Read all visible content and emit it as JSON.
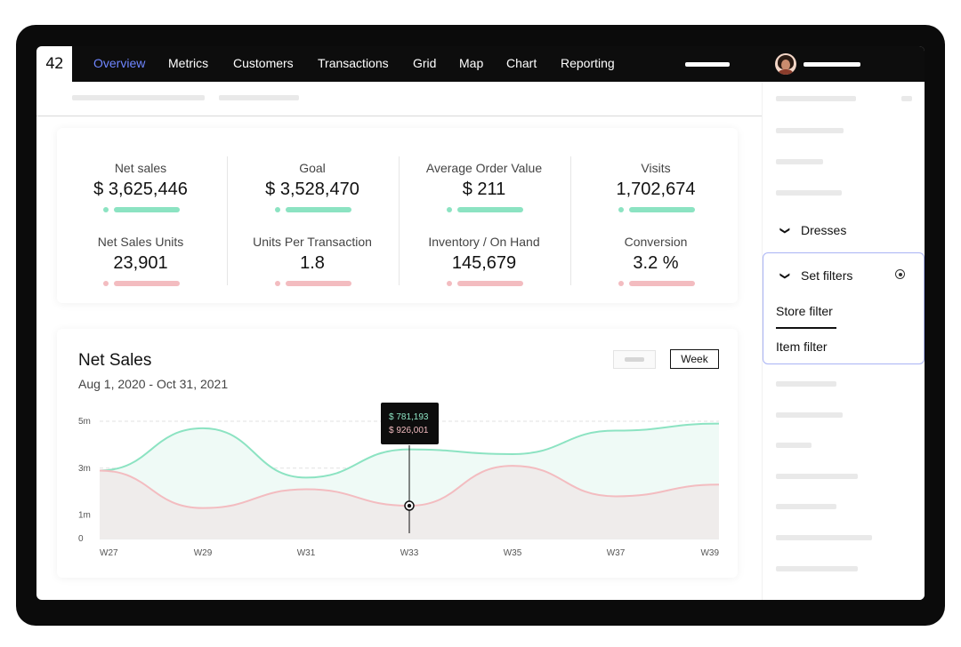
{
  "app": {
    "logo": "42"
  },
  "nav": {
    "items": [
      "Overview",
      "Metrics",
      "Customers",
      "Transactions",
      "Grid",
      "Map",
      "Chart",
      "Reporting"
    ],
    "active": "Overview"
  },
  "kpis": [
    {
      "label": "Net sales",
      "value": "$ 3,625,446",
      "status": "green"
    },
    {
      "label": "Goal",
      "value": "$ 3,528,470",
      "status": "green"
    },
    {
      "label": "Average Order Value",
      "value": "$ 211",
      "status": "green"
    },
    {
      "label": "Visits",
      "value": "1,702,674",
      "status": "green"
    },
    {
      "label": "Net Sales Units",
      "value": "23,901",
      "status": "pink"
    },
    {
      "label": "Units Per Transaction",
      "value": "1.8",
      "status": "pink"
    },
    {
      "label": "Inventory / On Hand",
      "value": "145,679",
      "status": "pink"
    },
    {
      "label": "Conversion",
      "value": "3.2 %",
      "status": "pink"
    }
  ],
  "chart_section": {
    "title": "Net Sales",
    "date_range": "Aug 1, 2020 - Oct 31, 2021",
    "period_button": "Week",
    "tooltip": {
      "line1": "$ 781,193",
      "line2": "$ 926,001"
    }
  },
  "chart_data": {
    "type": "area",
    "yticks": [
      "0",
      "1m",
      "3m",
      "5m"
    ],
    "ylim": [
      0,
      5
    ],
    "xticks": [
      "W27",
      "W29",
      "W31",
      "W33",
      "W35",
      "W37",
      "W39"
    ],
    "series": [
      {
        "color": "#8ce3c2",
        "x": [
          27,
          29,
          31,
          33,
          35,
          37,
          39
        ],
        "values": [
          2.9,
          4.7,
          2.6,
          3.8,
          3.6,
          4.6,
          4.9
        ]
      },
      {
        "color": "#f3bcc0",
        "x": [
          27,
          29,
          31,
          33,
          35,
          37,
          39
        ],
        "values": [
          2.9,
          1.3,
          2.1,
          1.4,
          3.1,
          1.8,
          2.3
        ]
      }
    ],
    "grid": true,
    "highlight_x": 33
  },
  "right_panel": {
    "dresses_label": "Dresses",
    "set_filters_label": "Set filters",
    "store_filter_label": "Store filter",
    "item_filter_label": "Item filter"
  },
  "colors": {
    "accent": "#6f86ff",
    "green": "#8ce3c2",
    "pink": "#f3bcc0",
    "dark": "#0d0d0d",
    "filter_border": "#aab4f5"
  }
}
